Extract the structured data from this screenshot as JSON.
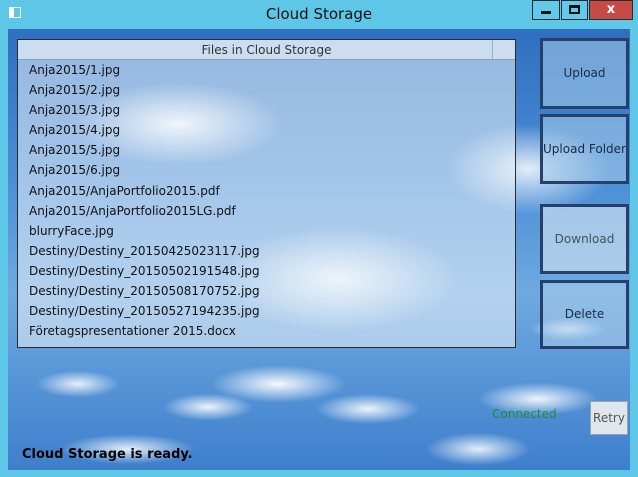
{
  "window": {
    "title": "Cloud Storage",
    "close_glyph": "x"
  },
  "file_list": {
    "header": "Files in Cloud Storage",
    "items": [
      "Anja2015/1.jpg",
      "Anja2015/2.jpg",
      "Anja2015/3.jpg",
      "Anja2015/4.jpg",
      "Anja2015/5.jpg",
      "Anja2015/6.jpg",
      "Anja2015/AnjaPortfolio2015.pdf",
      "Anja2015/AnjaPortfolio2015LG.pdf",
      "blurryFace.jpg",
      "Destiny/Destiny_20150425023117.jpg",
      "Destiny/Destiny_20150502191548.jpg",
      "Destiny/Destiny_20150508170752.jpg",
      "Destiny/Destiny_20150527194235.jpg",
      "Företagspresentationer 2015.docx"
    ]
  },
  "actions": {
    "upload": "Upload",
    "upload_folder": "Upload Folder",
    "download": "Download",
    "delete": "Delete",
    "retry": "Retry"
  },
  "connection": {
    "text": "Connected",
    "color": "#1f8a3a"
  },
  "status_text": "Cloud Storage is ready."
}
